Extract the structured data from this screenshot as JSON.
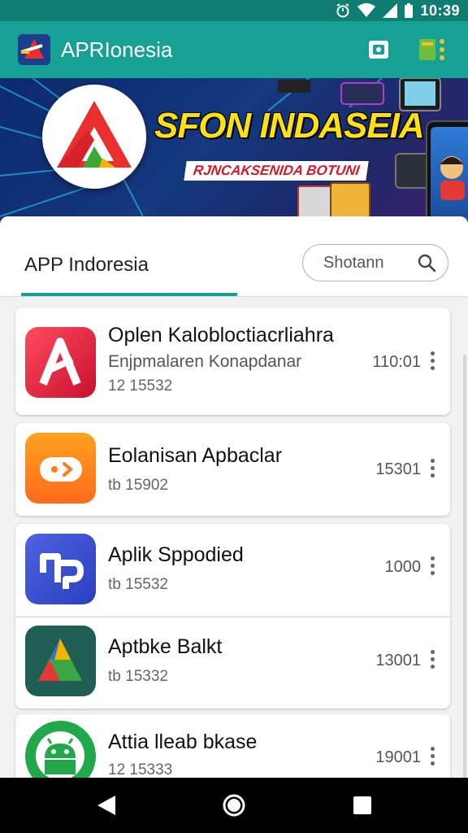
{
  "status_bar": {
    "time": "10:39"
  },
  "app_bar": {
    "title": "APRIonesia",
    "color": "#16a194",
    "icons": [
      "app-logo-icon",
      "screen-share-icon",
      "overflow-menu-icon"
    ]
  },
  "banner": {
    "title": "SFON INDASEIA",
    "subtitle": "RJNCAKSENIDA BOTUNI"
  },
  "tab": {
    "label": "APP Indoresia"
  },
  "search": {
    "placeholder": "Shotann"
  },
  "apps": [
    {
      "name": "Oplen Kalobloctiacrliahra",
      "subtitle": "Enjpmalaren Konapdanar",
      "meta": "12 15532",
      "count": "110:01",
      "icon": "red-arrow-app-icon"
    },
    {
      "name": "Eolanisan Apbaclar",
      "meta": "tb 15902",
      "count": "15301",
      "icon": "orange-play-app-icon"
    },
    {
      "name": "Aplik Sppodied",
      "meta": "tb 15532",
      "count": "1000",
      "icon": "blue-connector-app-icon"
    },
    {
      "name": "Aptbke Balkt",
      "meta": "tb 15332",
      "count": "13001",
      "icon": "green-triangle-app-icon"
    },
    {
      "name": "Attia lleab bkase",
      "meta": "12 15333",
      "count": "19001",
      "icon": "android-app-icon"
    }
  ],
  "colors": {
    "accent": "#16a194",
    "status_bar": "#0f7d72",
    "banner_title": "#ffe014"
  }
}
